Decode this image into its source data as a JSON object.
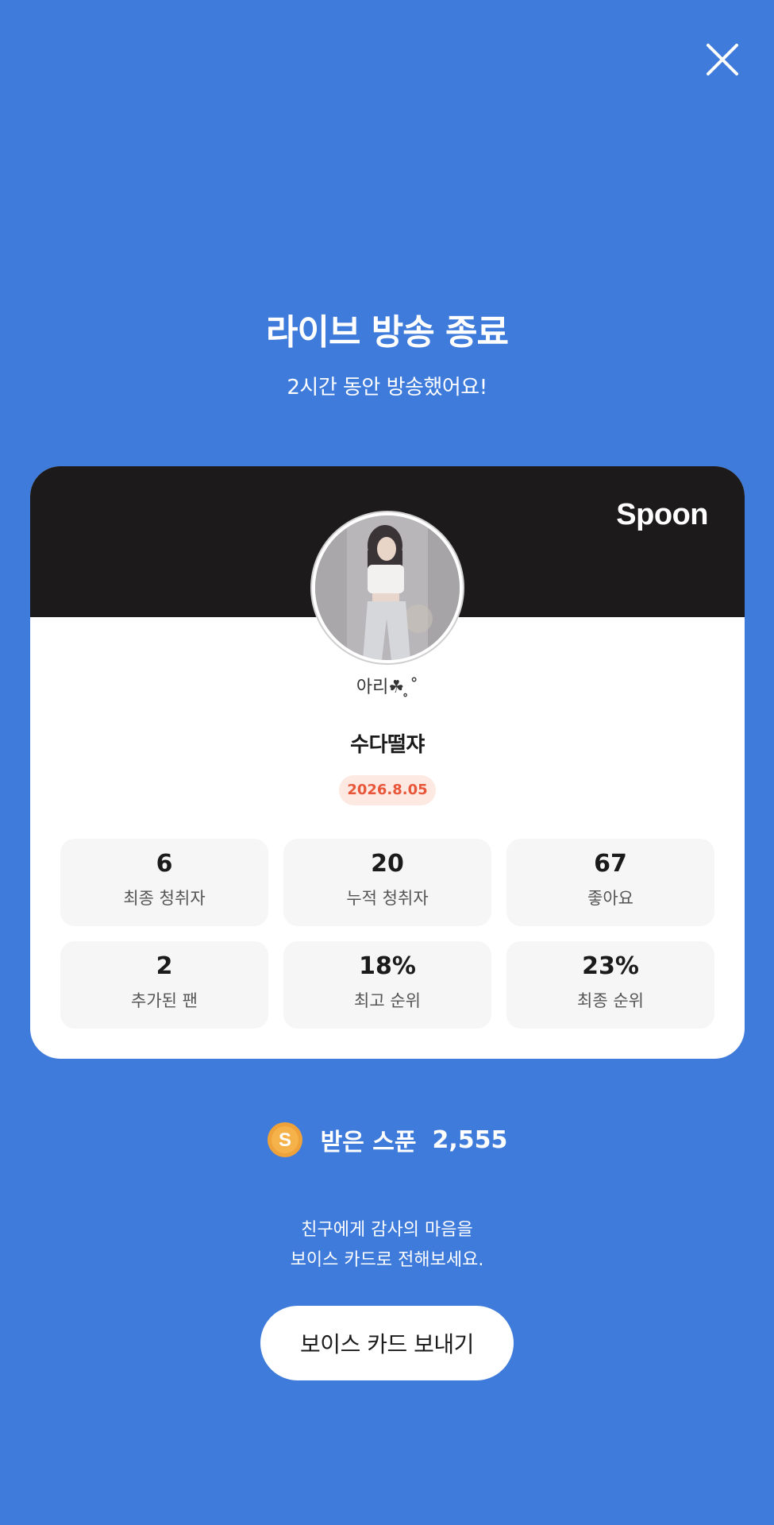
{
  "header": {
    "title": "라이브 방송 종료",
    "subtitle": "2시간 동안 방송했어요!"
  },
  "card": {
    "brand": "Spoon",
    "username": "아리☘︎ ̥˚",
    "room_title": "수다떨쟈",
    "date": "2026.8.05",
    "stats": [
      {
        "value": "6",
        "label": "최종 청취자"
      },
      {
        "value": "20",
        "label": "누적 청취자"
      },
      {
        "value": "67",
        "label": "좋아요"
      },
      {
        "value": "2",
        "label": "추가된 팬"
      },
      {
        "value": "18%",
        "label": "최고 순위"
      },
      {
        "value": "23%",
        "label": "최종 순위"
      }
    ]
  },
  "spoons": {
    "label": "받은 스푼",
    "value": "2,555",
    "icon": "spoon-coin-icon"
  },
  "message": {
    "line1": "친구에게 감사의 마음을",
    "line2": "보이스 카드로 전해보세요."
  },
  "actions": {
    "send_label": "보이스 카드 보내기",
    "close_icon": "close-icon"
  },
  "colors": {
    "background": "#3f7bdb",
    "card_header": "#1c1a1b",
    "date_badge_bg": "#fde8e2",
    "date_badge_text": "#e8573a",
    "stat_bg": "#f6f6f6",
    "coin": "#f0a23a"
  }
}
